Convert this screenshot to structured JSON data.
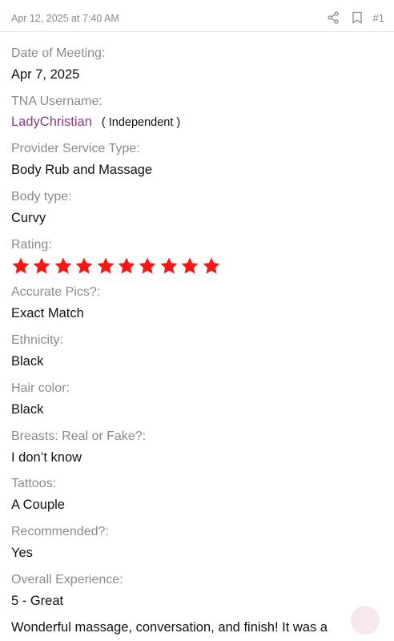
{
  "post": {
    "timestamp": "Apr 12, 2025 at 7:40 AM",
    "number": "#1"
  },
  "icons": {
    "share": "share-icon",
    "bookmark": "bookmark-icon",
    "star": "star-icon",
    "reaction": "reaction-icon"
  },
  "colors": {
    "star": "#ff1414",
    "username": "#8a3d7e",
    "label": "#8b8b8b"
  },
  "fields": {
    "date_of_meeting": {
      "label": "Date of Meeting:",
      "value": "Apr 7, 2025"
    },
    "tna_username": {
      "label": "TNA Username:",
      "value": "LadyChristian",
      "badge": "( Independent )"
    },
    "provider_service_type": {
      "label": "Provider Service Type:",
      "value": "Body Rub and Massage"
    },
    "body_type": {
      "label": "Body type:",
      "value": "Curvy"
    },
    "rating": {
      "label": "Rating:",
      "stars": 10,
      "max": 10
    },
    "accurate_pics": {
      "label": "Accurate Pics?:",
      "value": "Exact Match"
    },
    "ethnicity": {
      "label": "Ethnicity:",
      "value": "Black"
    },
    "hair_color": {
      "label": "Hair color:",
      "value": "Black"
    },
    "breasts": {
      "label": "Breasts: Real or Fake?:",
      "value": "I don’t know"
    },
    "tattoos": {
      "label": "Tattoos:",
      "value": "A Couple"
    },
    "recommended": {
      "label": "Recommended?:",
      "value": "Yes"
    },
    "overall_experience": {
      "label": "Overall Experience:",
      "value": "5 - Great"
    }
  },
  "body": {
    "text": "Wonderful massage, conversation, and finish! It was a"
  }
}
